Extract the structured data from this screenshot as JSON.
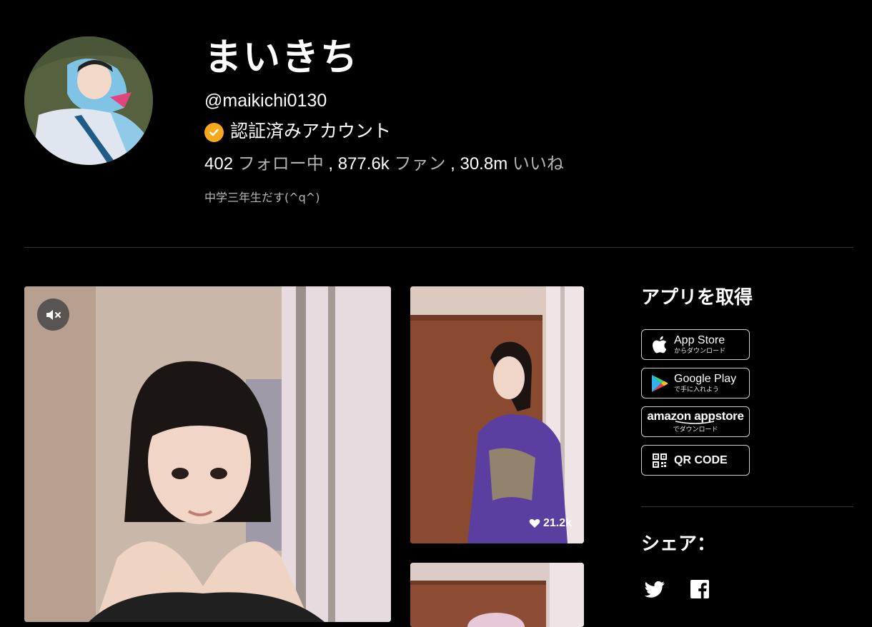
{
  "profile": {
    "display_name": "まいきち",
    "username": "@maikichi0130",
    "verified_label": "認証済みアカウント",
    "stats": {
      "following_count": "402",
      "following_label": "フォロー中",
      "fans_count": "877.6k",
      "fans_label": "ファン",
      "likes_count": "30.8m",
      "likes_label": "いいね",
      "separator": " , "
    },
    "bio": "中学三年生だす(^q^)",
    "verified_color": "#f5a81c"
  },
  "videos": [
    {
      "kind": "main",
      "muted": true
    },
    {
      "kind": "thumbnail",
      "likes": "21.2k"
    },
    {
      "kind": "thumbnail"
    }
  ],
  "sidebar": {
    "get_app_title": "アプリを取得",
    "buttons": {
      "app_store": {
        "main": "App Store",
        "sub": "からダウンロード",
        "icon": "apple-icon"
      },
      "google_play": {
        "main": "Google Play",
        "sub": "で手に入れよう",
        "icon": "google-play-icon"
      },
      "amazon": {
        "main": "amazon appstore",
        "sub": "でダウンロード"
      },
      "qr": {
        "main": "QR CODE",
        "icon": "qr-code-icon"
      }
    },
    "share_title": "シェア：",
    "share_icons": [
      "twitter-icon",
      "facebook-icon"
    ]
  }
}
